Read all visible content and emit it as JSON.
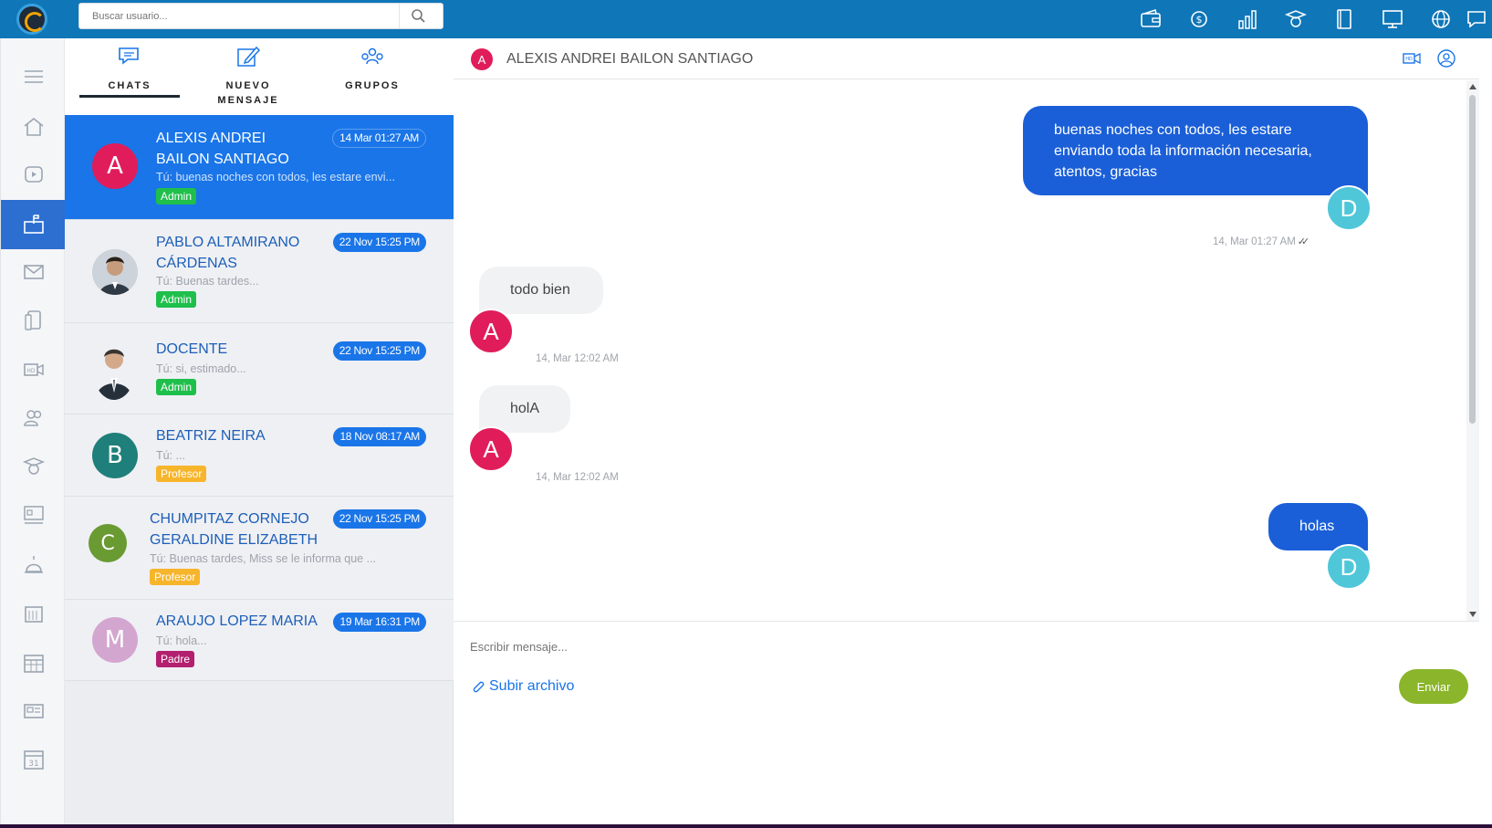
{
  "search": {
    "placeholder": "Buscar usuario..."
  },
  "colors": {
    "topbar": "#0f76b8",
    "accent": "#1a75e8",
    "send": "#8bb52a",
    "admin": "#1fbf4b",
    "profesor": "#f7b52c",
    "padre": "#b3206f"
  },
  "topbar_icons": [
    "wallet-icon",
    "money-icon",
    "bar-chart-icon",
    "graduate-icon",
    "book-icon",
    "monitor-icon",
    "globe-icon",
    "chat-icon"
  ],
  "nav_icons": [
    "menu-icon",
    "home-icon",
    "video-play-icon",
    "mailbox-icon",
    "envelope-icon",
    "devices-icon",
    "hd-video-icon",
    "users-icon",
    "graduate-icon",
    "classroom-icon",
    "alarm-icon",
    "calendar-grid-icon",
    "calendar-icon",
    "news-icon",
    "calendar-31-icon"
  ],
  "tabs": [
    {
      "label": "CHATS"
    },
    {
      "label": "NUEVO MENSAJE"
    },
    {
      "label": "GRUPOS"
    }
  ],
  "chats": [
    {
      "initial": "A",
      "name": "ALEXIS ANDREI BAILON SANTIAGO",
      "date": "14 Mar 01:27 AM",
      "preview": "Tú: buenas noches con todos, les estare envi...",
      "role": "Admin"
    },
    {
      "initial": "",
      "name": "PABLO ALTAMIRANO CÁRDENAS",
      "date": "22 Nov 15:25 PM",
      "preview": "Tú: Buenas tardes...",
      "role": "Admin"
    },
    {
      "initial": "",
      "name": "DOCENTE",
      "date": "22 Nov 15:25 PM",
      "preview": "Tú: si, estimado...",
      "role": "Admin"
    },
    {
      "initial": "B",
      "name": "BEATRIZ NEIRA",
      "date": "18 Nov 08:17 AM",
      "preview": "Tú: ...",
      "role": "Profesor"
    },
    {
      "initial": "C",
      "name": "CHUMPITAZ CORNEJO GERALDINE ELIZABETH",
      "date": "22 Nov 15:25 PM",
      "preview": "Tú: Buenas tardes, Miss se le informa que ...",
      "role": "Profesor"
    },
    {
      "initial": "M",
      "name": "ARAUJO LOPEZ MARIA",
      "date": "19 Mar 16:31 PM",
      "preview": "Tú: hola...",
      "role": "Padre"
    }
  ],
  "conversation": {
    "initial": "A",
    "title": "ALEXIS ANDREI BAILON SANTIAGO",
    "messages": [
      {
        "dir": "out",
        "text": "buenas noches con todos, les estare enviando toda la información necesaria, atentos, gracias",
        "avatar": "D",
        "time": "14, Mar 01:27 AM"
      },
      {
        "dir": "in",
        "text": "todo bien",
        "avatar": "A",
        "time": "14, Mar 12:02 AM"
      },
      {
        "dir": "in",
        "text": "holA",
        "avatar": "A",
        "time": "14, Mar 12:02 AM"
      },
      {
        "dir": "out",
        "text": "holas",
        "avatar": "D",
        "time": ""
      }
    ]
  },
  "composer": {
    "placeholder": "Escribir mensaje...",
    "upload_label": "Subir archivo",
    "send_label": "Enviar"
  }
}
